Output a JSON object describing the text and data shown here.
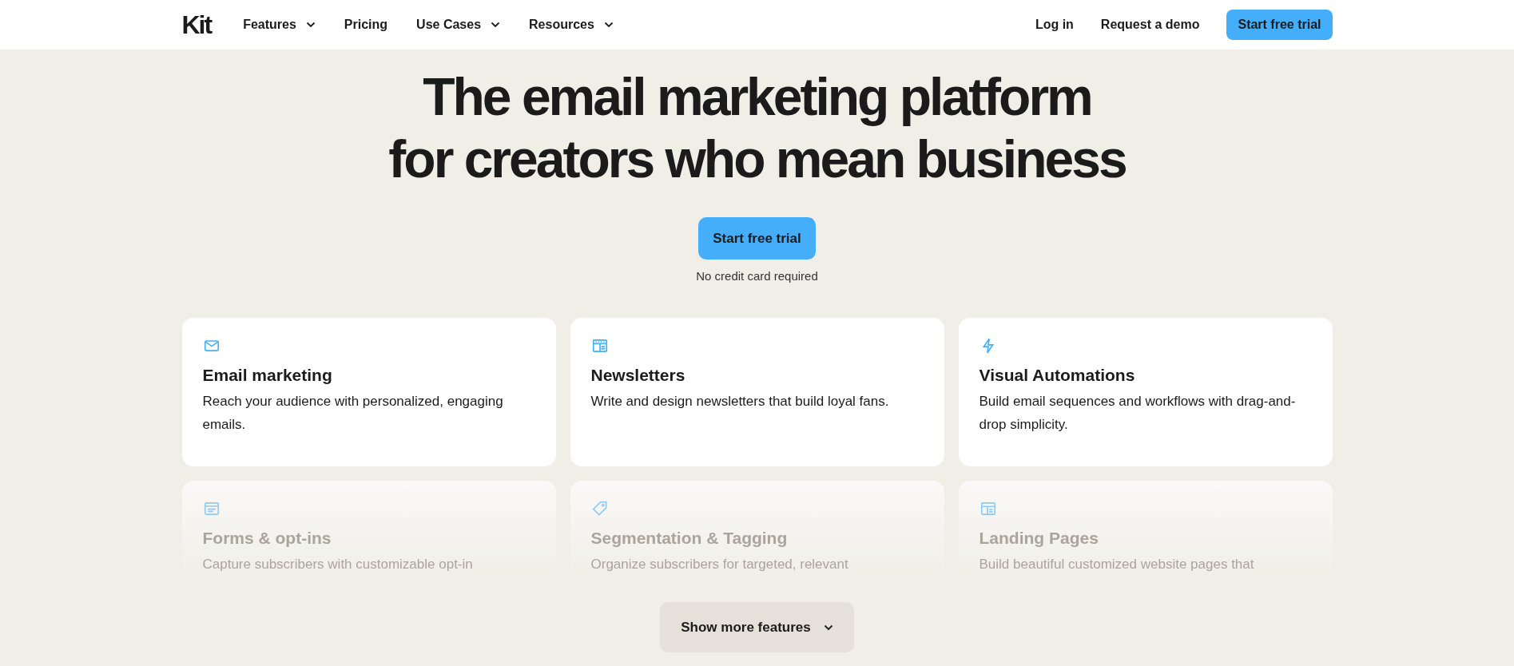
{
  "nav": {
    "logo": "Kit",
    "links": [
      {
        "label": "Features",
        "dropdown": true
      },
      {
        "label": "Pricing",
        "dropdown": false
      },
      {
        "label": "Use Cases",
        "dropdown": true
      },
      {
        "label": "Resources",
        "dropdown": true
      }
    ],
    "login": "Log in",
    "demo": "Request a demo",
    "cta": "Start free trial"
  },
  "hero": {
    "lines": [
      "The email marketing platform",
      "for creators who mean business"
    ],
    "cta": "Start free trial",
    "note": "No credit card required"
  },
  "features": [
    {
      "title": "Email marketing",
      "text": "Reach your audience with personalized, engaging emails.",
      "faded": false
    },
    {
      "title": "Newsletters",
      "text": "Write and design newsletters that build loyal fans.",
      "faded": false
    },
    {
      "title": "Visual Automations",
      "text": "Build email sequences and workflows with drag-and-drop simplicity.",
      "faded": false
    },
    {
      "title": "Forms & opt-ins",
      "text": "Capture subscribers with customizable opt-in",
      "faded": true
    },
    {
      "title": "Segmentation & Tagging",
      "text": "Organize subscribers for targeted, relevant",
      "faded": true
    },
    {
      "title": "Landing Pages",
      "text": "Build beautiful customized website pages that",
      "faded": true
    }
  ],
  "more": {
    "label": "Show more features"
  }
}
